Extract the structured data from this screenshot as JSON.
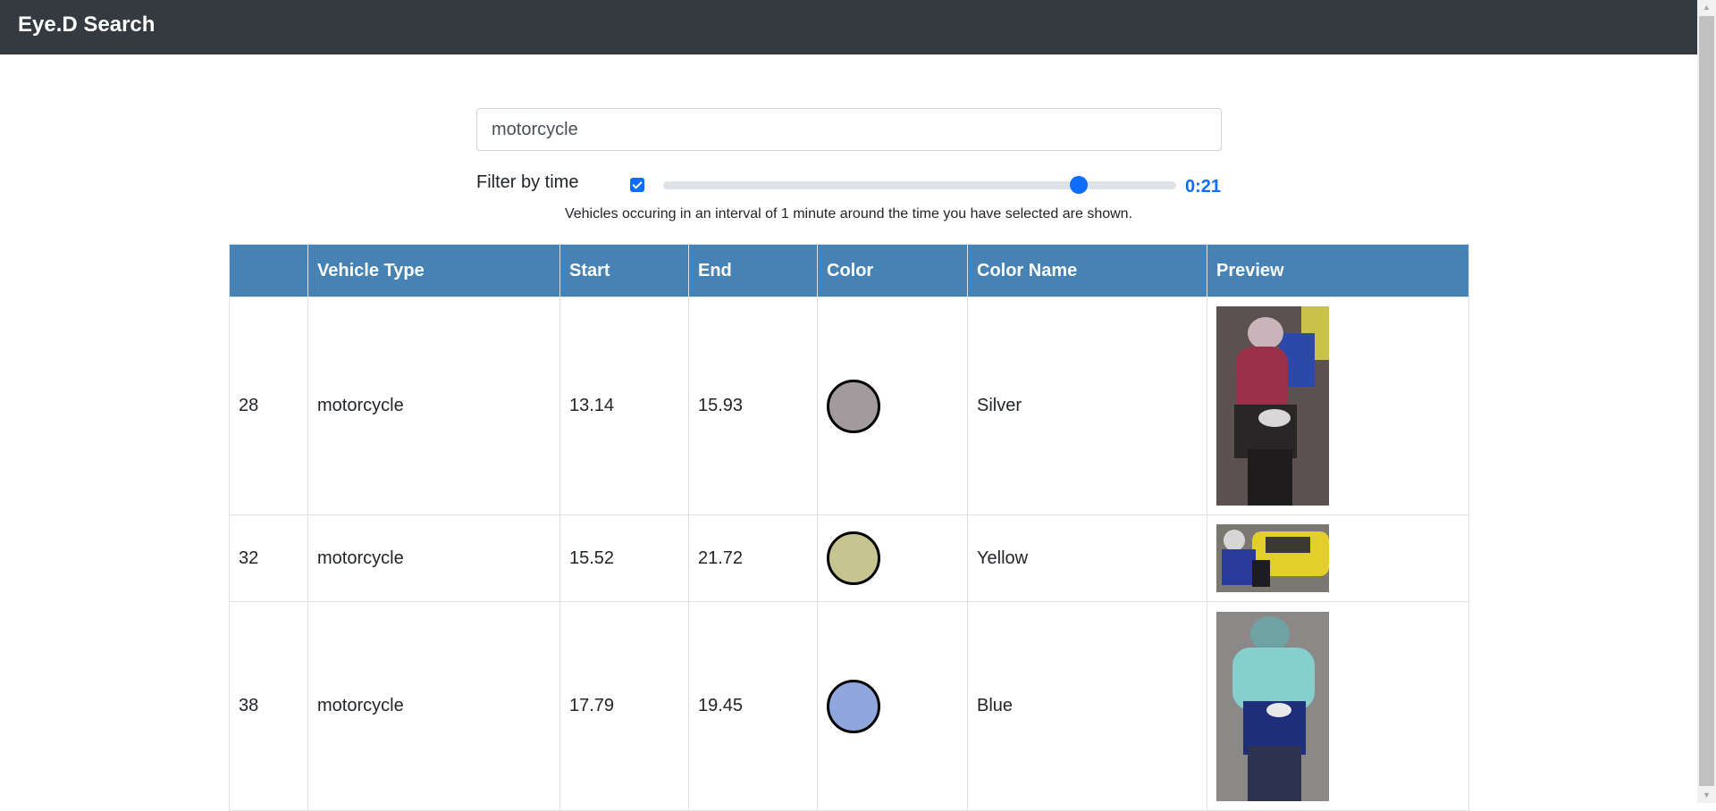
{
  "app": {
    "title": "Eye.D Search"
  },
  "search": {
    "value": "motorcycle"
  },
  "filter": {
    "label": "Filter by time",
    "checked": true,
    "slider_fraction": 0.81,
    "value_label": "0:21",
    "hint": "Vehicles occuring in an interval of 1 minute around the time you have selected are shown."
  },
  "table": {
    "headers": [
      "",
      "Vehicle Type",
      "Start",
      "End",
      "Color",
      "Color Name",
      "Preview"
    ],
    "rows": [
      {
        "id": "28",
        "type": "motorcycle",
        "start": "13.14",
        "end": "15.93",
        "color": "#a39a9d",
        "color_name": "Silver",
        "preview_icon": "motorcycle-rider-red-jacket-image"
      },
      {
        "id": "32",
        "type": "motorcycle",
        "start": "15.52",
        "end": "21.72",
        "color": "#c6c490",
        "color_name": "Yellow",
        "preview_icon": "motorcycle-near-yellow-car-image"
      },
      {
        "id": "38",
        "type": "motorcycle",
        "start": "17.79",
        "end": "19.45",
        "color": "#8fa7dc",
        "color_name": "Blue",
        "preview_icon": "motorcycle-rider-teal-jacket-image"
      }
    ]
  }
}
